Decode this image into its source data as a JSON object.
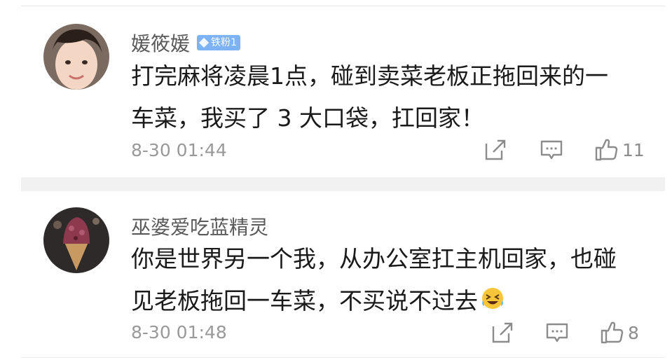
{
  "comments": [
    {
      "username": "媛筱媛",
      "badge": "铁粉1",
      "lines": [
        "打完麻将凌晨1点，碰到卖菜老板正拖回来的一",
        "车菜，我买了 3 大口袋，扛回家！"
      ],
      "time": "8-30 01:44",
      "likes": "11"
    },
    {
      "username": "巫婆爱吃蓝精灵",
      "lines": [
        "你是世界另一个我，从办公室扛主机回家，也碰",
        "见老板拖回一车菜，不买说不过去"
      ],
      "emoji": "laugh-crying",
      "time": "8-30 01:48",
      "likes": "8"
    }
  ],
  "icons": [
    "share-icon",
    "comment-icon",
    "like-icon"
  ]
}
